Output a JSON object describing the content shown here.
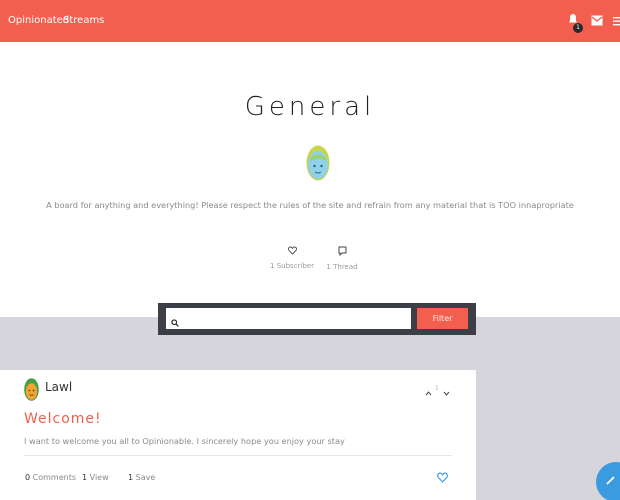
{
  "nav": {
    "brand": "Opinionated",
    "streams": "Streams",
    "notification_count": "1",
    "icons": [
      "bell-icon",
      "mail-icon",
      "menu-icon"
    ]
  },
  "board": {
    "title": "General",
    "description": "A board for anything and everything! Please respect the rules of the site and refrain from any material that is TOO innapropriate",
    "subscribers_label": "1 Subscriber",
    "threads_label": "1 Thread"
  },
  "search": {
    "placeholder": "",
    "value": "",
    "filter_label": "Filter"
  },
  "post": {
    "author": "Lawl",
    "vote_count": "1",
    "title": "Welcome!",
    "body": "I want to welcome you all to Opinionable. I sincerely hope you enjoy your stay",
    "comments_count": "0",
    "comments_label": "Comments",
    "views_count": "1",
    "views_label": "View",
    "saves_count": "1",
    "saves_label": "Save"
  },
  "colors": {
    "accent": "#f25f4f",
    "feed_background": "#d6d5db",
    "search_bar": "#3c3f45",
    "fab": "#3a9be0"
  }
}
